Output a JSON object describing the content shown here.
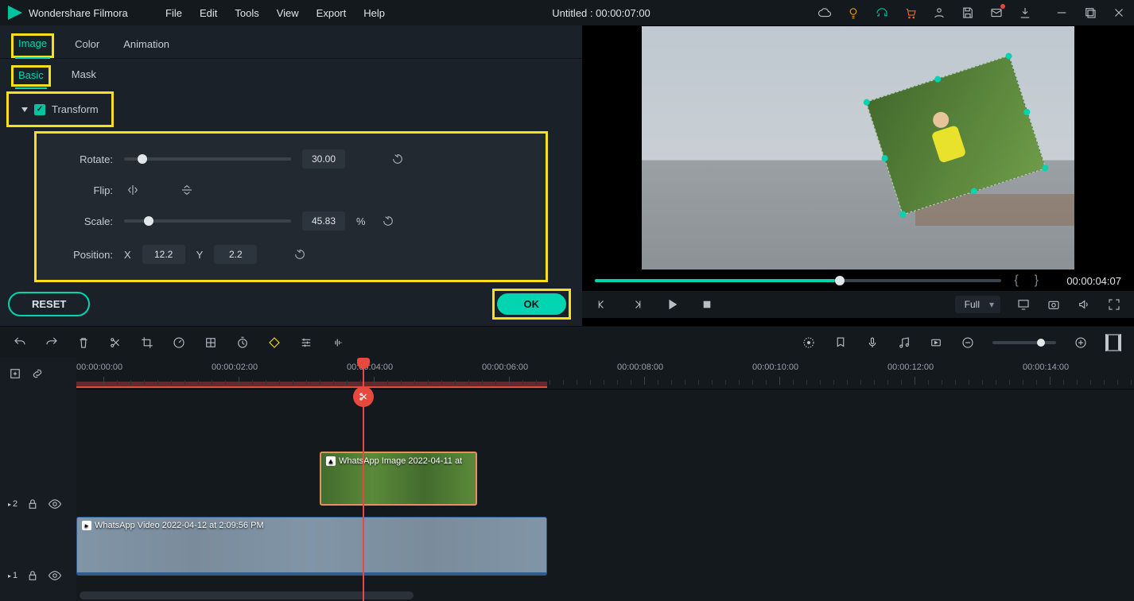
{
  "app": {
    "name": "Wondershare Filmora",
    "title": "Untitled : 00:00:07:00"
  },
  "menu": {
    "file": "File",
    "edit": "Edit",
    "tools": "Tools",
    "view": "View",
    "export": "Export",
    "help": "Help"
  },
  "tabs": {
    "image": "Image",
    "color": "Color",
    "animation": "Animation",
    "basic": "Basic",
    "mask": "Mask"
  },
  "transform": {
    "section": "Transform",
    "rotate_label": "Rotate:",
    "rotate_value": "30.00",
    "rotate_pct": 8,
    "flip_label": "Flip:",
    "scale_label": "Scale:",
    "scale_value": "45.83",
    "scale_pct": 12,
    "scale_unit": "%",
    "position_label": "Position:",
    "x_label": "X",
    "x_value": "12.2",
    "y_label": "Y",
    "y_value": "2.2"
  },
  "buttons": {
    "reset": "RESET",
    "ok": "OK"
  },
  "preview": {
    "timecode": "00:00:04:07",
    "quality": "Full",
    "progress_pct": 59
  },
  "ruler": {
    "ticks": [
      {
        "pos": 0,
        "label": "00:00:00:00"
      },
      {
        "pos": 170,
        "label": "00:00:02:00"
      },
      {
        "pos": 340,
        "label": "00:00:04:00"
      },
      {
        "pos": 510,
        "label": "00:00:06:00"
      },
      {
        "pos": 680,
        "label": "00:00:08:00"
      },
      {
        "pos": 850,
        "label": "00:00:10:00"
      },
      {
        "pos": 1020,
        "label": "00:00:12:00"
      },
      {
        "pos": 1190,
        "label": "00:00:14:00"
      }
    ]
  },
  "tracks": {
    "t2": "2",
    "t1": "1",
    "clip_image_name": "WhatsApp Image 2022-04-11 at",
    "clip_video_name": "WhatsApp Video 2022-04-12 at 2:09:56 PM"
  }
}
